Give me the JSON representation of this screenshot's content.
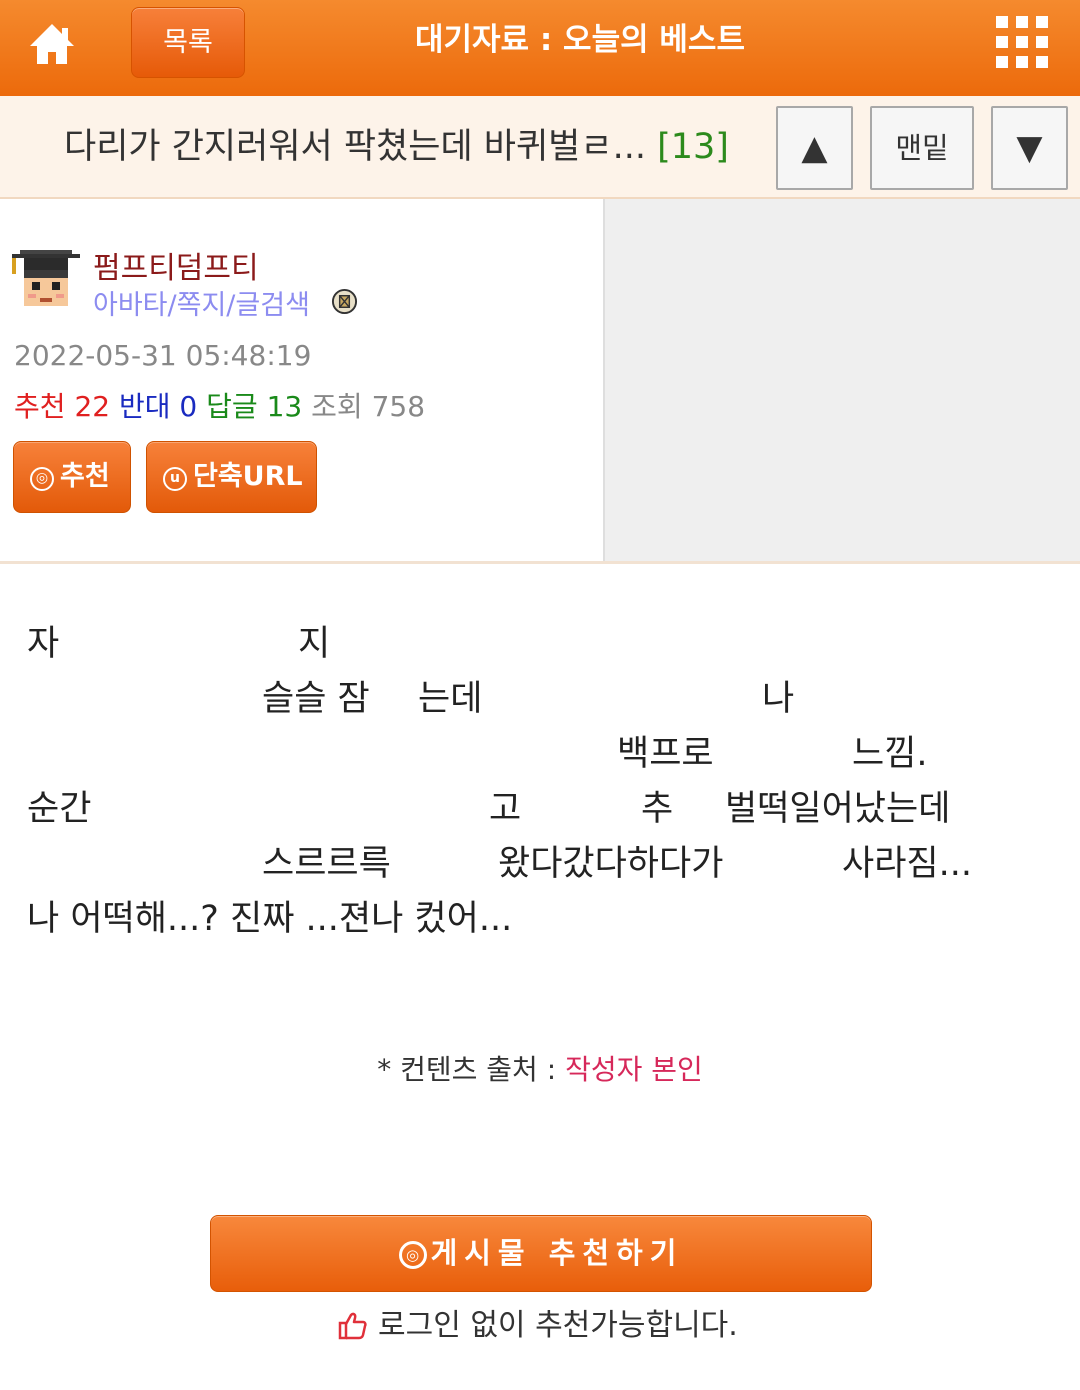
{
  "header": {
    "list_label": "목록",
    "title": "대기자료 : 오늘의 베스트",
    "icons": {
      "home": "home-icon",
      "menu": "grid-menu-icon"
    },
    "accent_color": "#ee6f12"
  },
  "post_bar": {
    "title": "다리가 간지러워서 팍쳤는데 바퀴벌ㄹ...",
    "reply_count": "[13]",
    "up_label": "▲",
    "bottom_label": "맨밑",
    "down_label": "▼"
  },
  "author": {
    "nickname": "펌프티덤프티",
    "links": "아바타/쪽지/글검색",
    "icons": {
      "avatar": "pixel-avatar-graduate",
      "badge": "badge-icon"
    }
  },
  "meta": {
    "datetime": "2022-05-31 05:48:19",
    "recommend_label": "추천",
    "recommend_value": "22",
    "oppose_label": "반대",
    "oppose_value": "0",
    "reply_label": "답글",
    "reply_value": "13",
    "views_label": "조회",
    "views_value": "758"
  },
  "actions": {
    "recommend_label": "추천",
    "recommend_icon": "◎",
    "short_url_label": "단축URL",
    "short_url_icon": "u"
  },
  "content": {
    "lines": [
      [
        "자",
        "지"
      ],
      [
        "슬슬 잠",
        "는데",
        "나"
      ],
      [
        "백프로",
        "느낌."
      ],
      [
        "순간",
        "고",
        "추",
        "벌떡일어났는데"
      ],
      [
        "스르르륵",
        "왔다갔다하다가",
        "사라짐..."
      ],
      [
        "나 어떡해...? 진짜 ...젼나 컸어..."
      ]
    ]
  },
  "source": {
    "label": "* 컨텐츠 출처 :",
    "value": "작성자 본인"
  },
  "footer": {
    "recommend_button": "게시물 추천하기",
    "recommend_icon": "◎",
    "login_note": "로그인 없이 추천가능합니다.",
    "thumb_icon": "thumbs-up-icon"
  }
}
